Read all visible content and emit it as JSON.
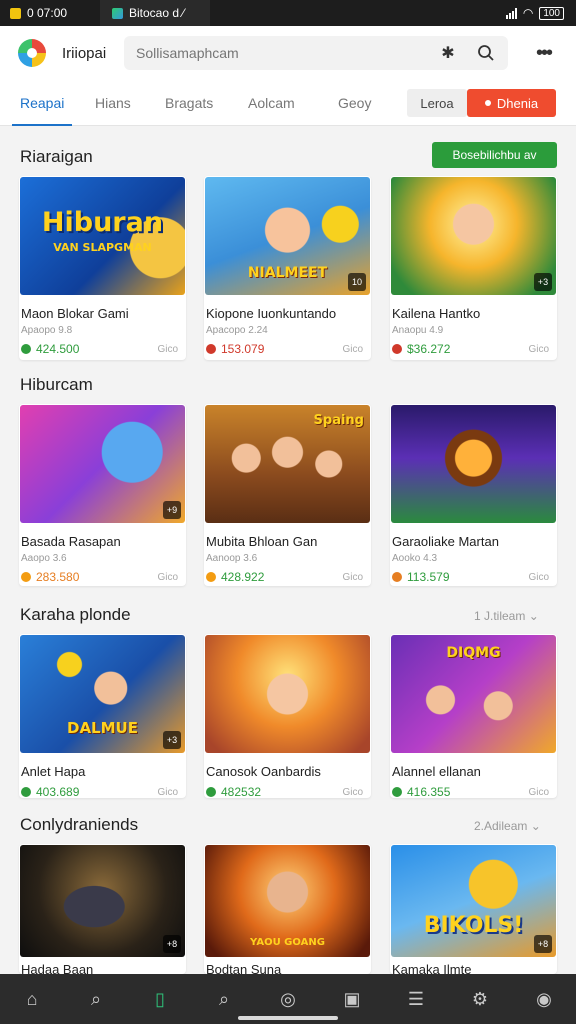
{
  "status_bar": {
    "time": "0 07:00",
    "notification": "Bitocao d ⁄",
    "battery": "100"
  },
  "header": {
    "app_name": "Iriiopai",
    "search_placeholder": "Sollisamaphcam"
  },
  "tabs": [
    "Reapai",
    "Hians",
    "Bragats",
    "Aolcam",
    "Geoy"
  ],
  "tab_buttons": {
    "secondary": "Leroa",
    "primary": "Dhenia"
  },
  "sections": [
    {
      "title": "Riaraigan",
      "action": "Bosebilichbu av",
      "cards": [
        {
          "title": "Maon Blokar Gami",
          "sub": "Apaopo 9.8",
          "price": "424.500",
          "meta": "Gico",
          "thumb_text": "Hiburan",
          "thumb_sub": "VAN SLAPGMAN",
          "badge": "",
          "dot": "#2f9c3d"
        },
        {
          "title": "Kiopone Iuonkuntando",
          "sub": "Apacopo 2.24",
          "price": "153.079",
          "meta": "Gico",
          "thumb_text": "NIALMEET",
          "thumb_sub": "",
          "badge": "10",
          "dot": "#d0392b"
        },
        {
          "title": "Kailena Hantko",
          "sub": "Anaopu 4.9",
          "price": "$36.272",
          "meta": "Gico",
          "thumb_text": "",
          "thumb_sub": "",
          "badge": "+3",
          "dot": "#d0392b"
        }
      ]
    },
    {
      "title": "Hiburcam",
      "action": "",
      "cards": [
        {
          "title": "Basada Rasapan",
          "sub": "Aaopo 3.6",
          "price": "283.580",
          "meta": "Gico",
          "thumb_text": "",
          "thumb_sub": "",
          "badge": "+9",
          "dot": "#f39c12"
        },
        {
          "title": "Mubita Bhloan Gan",
          "sub": "Aanoop 3.6",
          "price": "428.922",
          "meta": "Gico",
          "thumb_text": "Spaing",
          "thumb_sub": "",
          "badge": "",
          "dot": "#f39c12"
        },
        {
          "title": "Garaoliake Martan",
          "sub": "Aooko 4.3",
          "price": "113.579",
          "meta": "Gico",
          "thumb_text": "",
          "thumb_sub": "",
          "badge": "",
          "dot": "#e67e22"
        }
      ]
    },
    {
      "title": "Karaha plonde",
      "action": "1 J.tileam",
      "cards": [
        {
          "title": "Anlet Hapa",
          "sub": "",
          "price": "403.689",
          "meta": "Gico",
          "thumb_text": "DALMUE",
          "thumb_sub": "",
          "badge": "+3",
          "dot": "#2f9c3d"
        },
        {
          "title": "Canosok Oanbardis",
          "sub": "",
          "price": "482532",
          "meta": "Gico",
          "thumb_text": "",
          "thumb_sub": "",
          "badge": "",
          "dot": "#2f9c3d"
        },
        {
          "title": "Alannel ellanan",
          "sub": "",
          "price": "416.355",
          "meta": "Gico",
          "thumb_text": "DIQMG",
          "thumb_sub": "",
          "badge": "",
          "dot": "#2f9c3d"
        }
      ]
    },
    {
      "title": "Conlydraniends",
      "action": "2.Adileam",
      "cards": [
        {
          "title": "Hadaa Baan",
          "sub": "",
          "price": "",
          "meta": "",
          "thumb_text": "",
          "thumb_sub": "",
          "badge": "+8",
          "dot": ""
        },
        {
          "title": "Bodtan Suna",
          "sub": "",
          "price": "",
          "meta": "",
          "thumb_text": "",
          "thumb_sub": "YAOU GOANG",
          "badge": "",
          "dot": ""
        },
        {
          "title": "Kamaka Ilmte",
          "sub": "",
          "price": "",
          "meta": "",
          "thumb_text": "BIKOLS!",
          "thumb_sub": "",
          "badge": "+8",
          "dot": ""
        }
      ]
    }
  ],
  "bottom_nav": [
    "home-icon",
    "search-icon",
    "bookmark-icon",
    "explore-icon",
    "compass-icon",
    "gamepad-icon",
    "list-icon",
    "settings-icon",
    "profile-icon"
  ],
  "colors": {
    "accent": "#1c72c9",
    "primary_button": "#ef4c2f",
    "filter_button": "#2b9c3d",
    "price": "#2f9c3d"
  }
}
